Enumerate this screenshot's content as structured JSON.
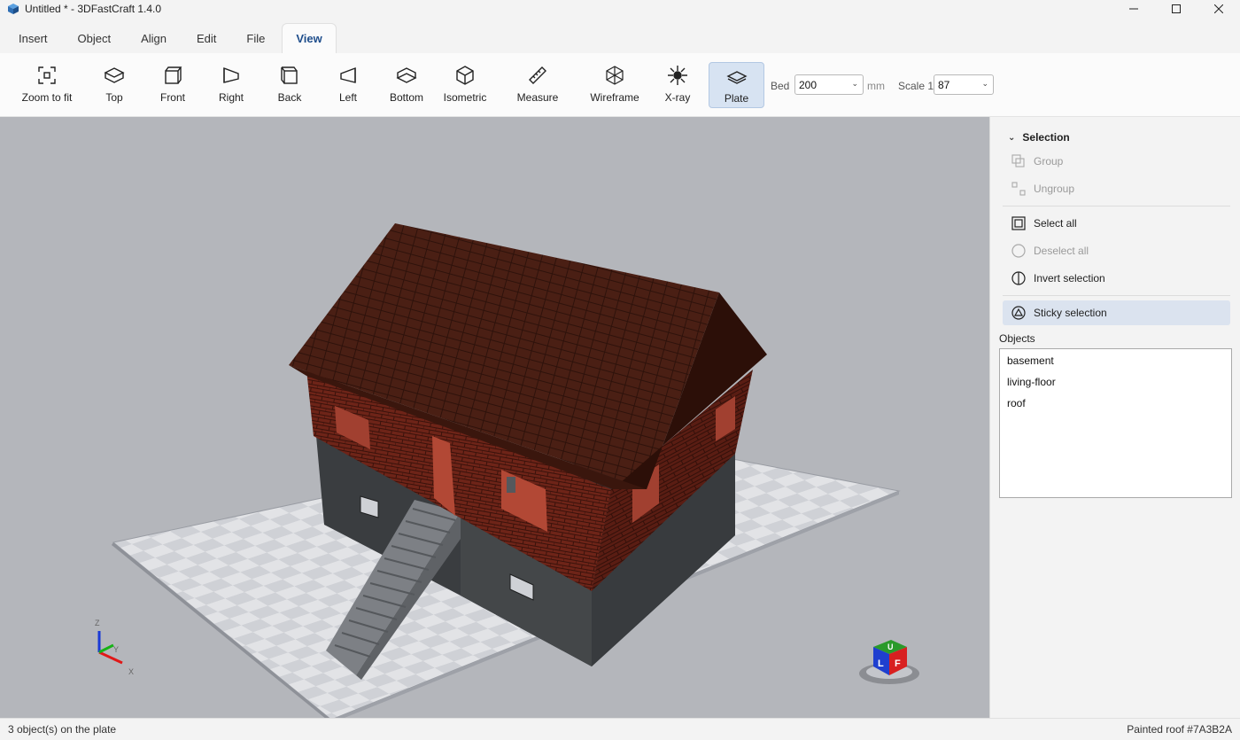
{
  "window": {
    "title": "Untitled * - 3DFastCraft 1.4.0"
  },
  "tabs": [
    {
      "label": "Insert"
    },
    {
      "label": "Object"
    },
    {
      "label": "Align"
    },
    {
      "label": "Edit"
    },
    {
      "label": "File"
    },
    {
      "label": "View",
      "active": true
    }
  ],
  "toolbar": {
    "buttons": [
      {
        "label": "Zoom to fit",
        "icon": "zoom-to-fit-icon"
      },
      {
        "label": "Top",
        "icon": "view-top-icon"
      },
      {
        "label": "Front",
        "icon": "view-front-icon"
      },
      {
        "label": "Right",
        "icon": "view-right-icon"
      },
      {
        "label": "Back",
        "icon": "view-back-icon"
      },
      {
        "label": "Left",
        "icon": "view-left-icon"
      },
      {
        "label": "Bottom",
        "icon": "view-bottom-icon"
      },
      {
        "label": "Isometric",
        "icon": "view-isometric-icon"
      },
      {
        "label": "Measure",
        "icon": "ruler-icon"
      },
      {
        "label": "Wireframe",
        "icon": "wireframe-cube-icon"
      },
      {
        "label": "X-ray",
        "icon": "xray-icon"
      },
      {
        "label": "Plate",
        "icon": "plate-icon",
        "active": true
      }
    ],
    "bed_label": "Bed",
    "bed_value": "200",
    "bed_unit": "mm",
    "scale_label": "Scale 1:",
    "scale_value": "87"
  },
  "panel": {
    "selection_title": "Selection",
    "items": [
      {
        "label": "Group",
        "icon": "group-icon",
        "enabled": false
      },
      {
        "label": "Ungroup",
        "icon": "ungroup-icon",
        "enabled": false
      },
      {
        "label": "Select all",
        "icon": "select-all-icon",
        "enabled": true
      },
      {
        "label": "Deselect all",
        "icon": "deselect-all-icon",
        "enabled": false
      },
      {
        "label": "Invert selection",
        "icon": "invert-selection-icon",
        "enabled": true
      },
      {
        "label": "Sticky selection",
        "icon": "sticky-selection-icon",
        "enabled": true,
        "active": true
      }
    ],
    "objects_title": "Objects",
    "objects": [
      "basement",
      "living-floor",
      "roof"
    ]
  },
  "axes": {
    "x": "X",
    "y": "Y",
    "z": "Z"
  },
  "view_cube": {
    "faces": [
      "U",
      "L",
      "F"
    ]
  },
  "colors": {
    "roof": "#7A3B2A",
    "accent": "#1f4e8c"
  },
  "status": {
    "left": "3 object(s) on the plate",
    "right": "Painted roof #7A3B2A"
  }
}
